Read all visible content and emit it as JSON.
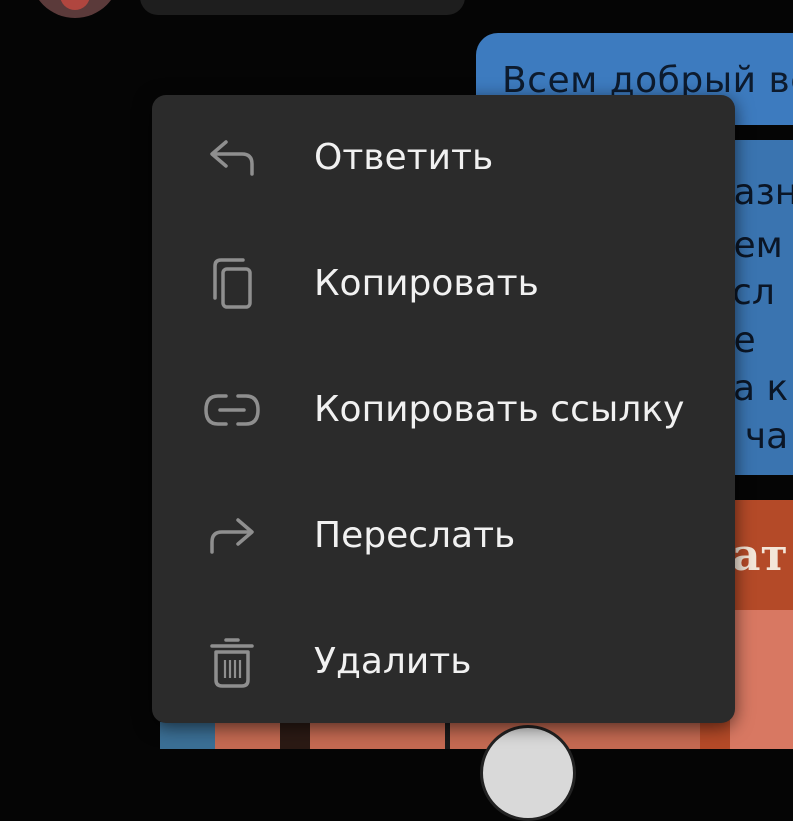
{
  "chat": {
    "outgoing_message_text": "Всем добрый ве",
    "second_bubble_fragments": [
      "назн",
      "нем",
      "осл",
      "не",
      "ла к",
      "й ча"
    ],
    "image_text_fragment": "ат"
  },
  "context_menu": {
    "items": [
      {
        "label": "Ответить",
        "icon": "reply-icon"
      },
      {
        "label": "Копировать",
        "icon": "copy-icon"
      },
      {
        "label": "Копировать ссылку",
        "icon": "link-icon"
      },
      {
        "label": "Переслать",
        "icon": "forward-icon"
      },
      {
        "label": "Удалить",
        "icon": "trash-icon"
      }
    ]
  },
  "colors": {
    "menu_background": "#2b2b2b",
    "icon_color": "#8f8f8f",
    "text_color": "#f1f1f1",
    "outgoing_bubble": "#3d7bbf"
  }
}
